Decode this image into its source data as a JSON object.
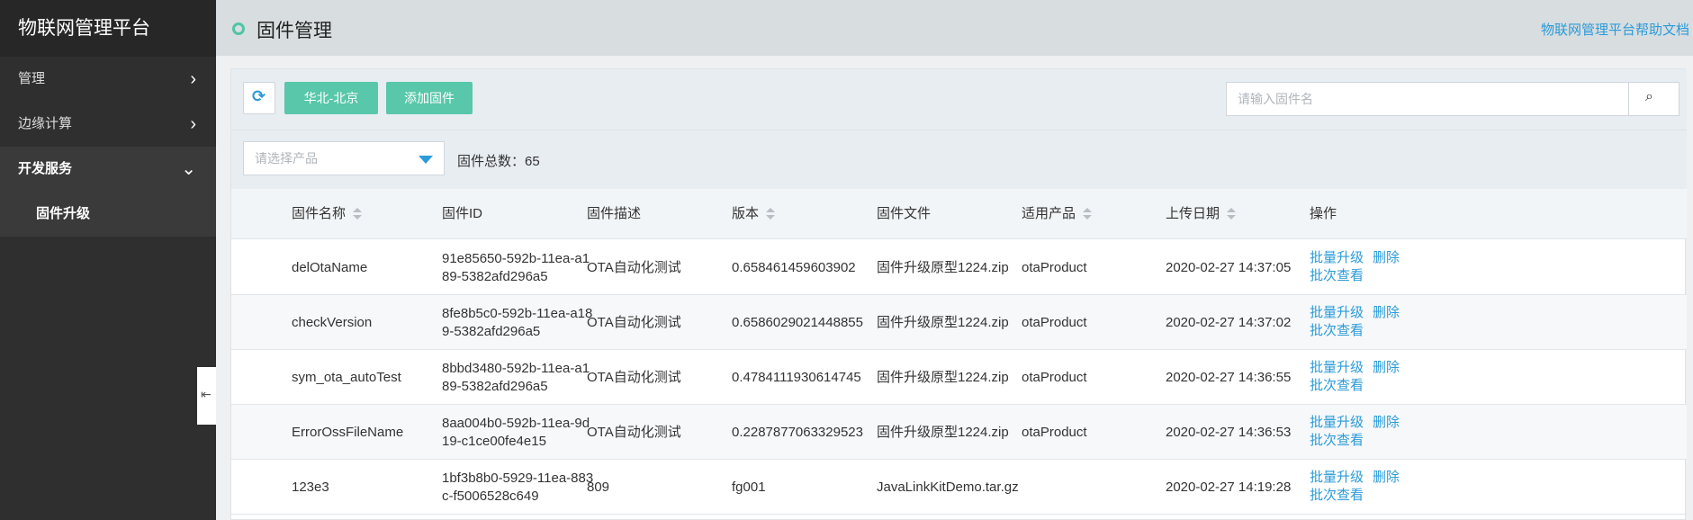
{
  "sidebar": {
    "brand": "物联网管理平台",
    "items": [
      {
        "label": "管理"
      },
      {
        "label": "边缘计算"
      },
      {
        "label": "开发服务"
      }
    ],
    "sub_item": "固件升级"
  },
  "header": {
    "title": "固件管理",
    "help_link": "物联网管理平台帮助文档"
  },
  "toolbar": {
    "region_button": "华北-北京",
    "add_button": "添加固件",
    "search_placeholder": "请输入固件名"
  },
  "filter": {
    "product_placeholder": "请选择产品",
    "total_label": "固件总数：65"
  },
  "table": {
    "columns": [
      "固件名称",
      "固件ID",
      "固件描述",
      "版本",
      "固件文件",
      "适用产品",
      "上传日期",
      "操作"
    ],
    "rows": [
      {
        "name": "delOtaName",
        "id": "91e85650-592b-11ea-a189-5382afd296a5",
        "desc": "OTA自动化测试",
        "version": "0.658461459603902",
        "file": "固件升级原型1224.zip",
        "product": "otaProduct",
        "date": "2020-02-27 14:37:05"
      },
      {
        "name": "checkVersion",
        "id": "8fe8b5c0-592b-11ea-a189-5382afd296a5",
        "desc": "OTA自动化测试",
        "version": "0.6586029021448855",
        "file": "固件升级原型1224.zip",
        "product": "otaProduct",
        "date": "2020-02-27 14:37:02"
      },
      {
        "name": "sym_ota_autoTest",
        "id": "8bbd3480-592b-11ea-a189-5382afd296a5",
        "desc": "OTA自动化测试",
        "version": "0.4784111930614745",
        "file": "固件升级原型1224.zip",
        "product": "otaProduct",
        "date": "2020-02-27 14:36:55"
      },
      {
        "name": "ErrorOssFileName",
        "id": "8aa004b0-592b-11ea-9d19-c1ce00fe4e15",
        "desc": "OTA自动化测试",
        "version": "0.2287877063329523",
        "file": "固件升级原型1224.zip",
        "product": "otaProduct",
        "date": "2020-02-27 14:36:53"
      },
      {
        "name": "123e3",
        "id": "1bf3b8b0-5929-11ea-883c-f5006528c649",
        "desc": "809",
        "version": "fg001",
        "file": "JavaLinkKitDemo.tar.gz",
        "product": "",
        "date": "2020-02-27 14:19:28"
      }
    ],
    "ops": {
      "upgrade": "批量升级",
      "delete": "删除",
      "view": "批次查看"
    }
  },
  "colors": {
    "accent": "#58c7aa",
    "link": "#2b9bd8",
    "sidebar": "#2f2f2f"
  }
}
